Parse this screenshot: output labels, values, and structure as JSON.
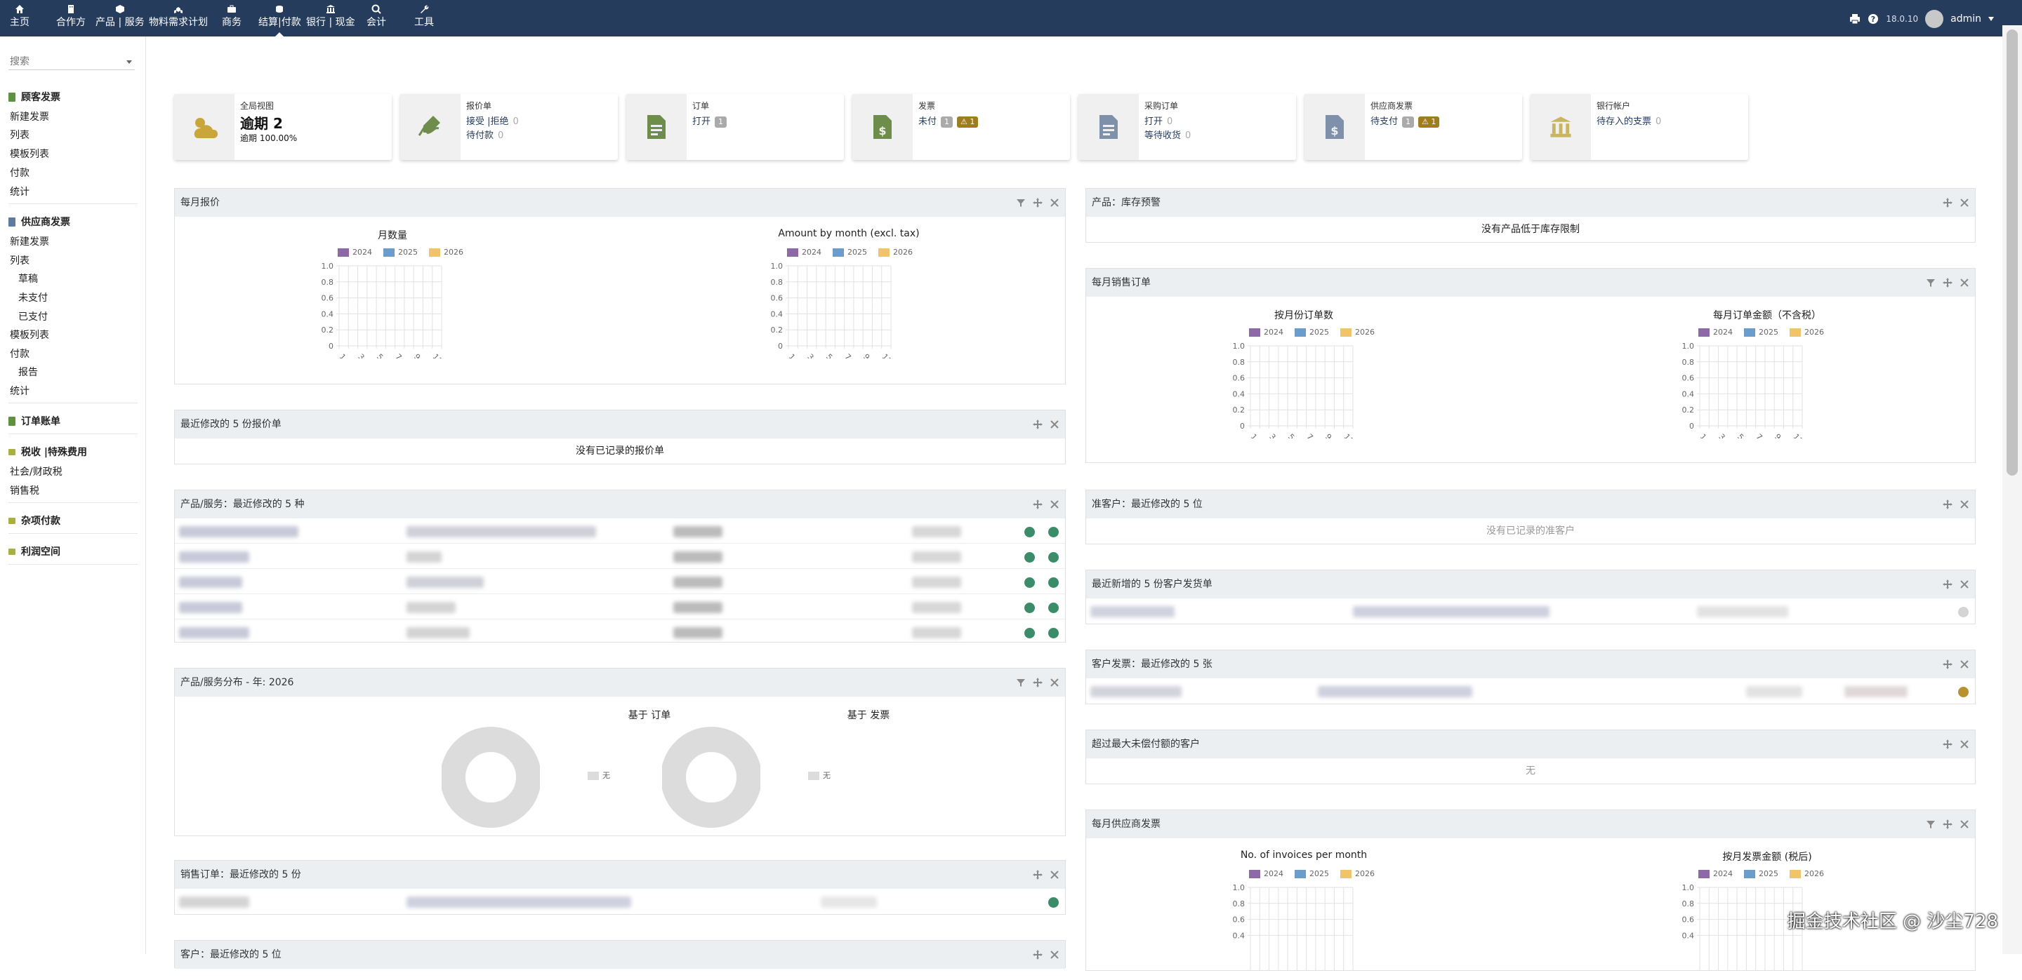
{
  "topnav": {
    "items": [
      {
        "label": "主页",
        "icon": "home-icon"
      },
      {
        "label": "合作方",
        "icon": "building-icon"
      },
      {
        "label": "产品 | 服务",
        "icon": "cube-icon"
      },
      {
        "label": "物料需求计划",
        "icon": "cubes-icon"
      },
      {
        "label": "商务",
        "icon": "briefcase-icon"
      },
      {
        "label": "结算|付款",
        "icon": "coins-icon",
        "active": true
      },
      {
        "label": "银行 | 现金",
        "icon": "bank-icon"
      },
      {
        "label": "会计",
        "icon": "search-dollar-icon"
      },
      {
        "label": "工具",
        "icon": "wrench-icon"
      }
    ],
    "version": "18.0.10",
    "user": "admin"
  },
  "sidebar": {
    "search_placeholder": "搜索",
    "customer_invoices": {
      "title": "顾客发票",
      "items": [
        "新建发票",
        "列表",
        "模板列表",
        "付款",
        "统计"
      ]
    },
    "supplier_invoices": {
      "title": "供应商发票",
      "items": [
        "新建发票",
        "列表",
        "草稿",
        "未支付",
        "已支付",
        "模板列表",
        "付款",
        "报告",
        "统计"
      ]
    },
    "orders_billing": {
      "title": "订单账单"
    },
    "taxes": {
      "title": "税收 |特殊费用",
      "items": [
        "社会/财政税",
        "销售税"
      ]
    },
    "misc_payments": {
      "title": "杂项付款"
    },
    "margins": {
      "title": "利润空间"
    }
  },
  "boxes": [
    {
      "title": "全局视图",
      "line1": "逾期 2",
      "line2": "逾期 100.00%",
      "icon": "weather-icon"
    },
    {
      "title": "报价单",
      "lines": [
        {
          "label": "接受 |拒绝",
          "count": "0"
        },
        {
          "label": "待付款",
          "count": "0"
        }
      ],
      "icon": "signature-icon"
    },
    {
      "title": "订单",
      "lines": [
        {
          "label": "打开",
          "badge": "1"
        }
      ],
      "icon": "order-doc-icon"
    },
    {
      "title": "发票",
      "lines": [
        {
          "label": "未付",
          "badge": "1",
          "warn": "1"
        }
      ],
      "icon": "invoice-dollar-icon"
    },
    {
      "title": "采购订单",
      "lines": [
        {
          "label": "打开",
          "count": "0"
        },
        {
          "label": "等待收货",
          "count": "0"
        }
      ],
      "icon": "purchase-doc-icon"
    },
    {
      "title": "供应商发票",
      "lines": [
        {
          "label": "待支付",
          "badge": "1",
          "warn": "1"
        }
      ],
      "icon": "supplier-invoice-icon"
    },
    {
      "title": "银行帐户",
      "lines": [
        {
          "label": "待存入的支票",
          "count": "0"
        }
      ],
      "icon": "bank-icon"
    }
  ],
  "panels": {
    "monthly_proposals": {
      "title": "每月报价",
      "chart1_title": "月数量",
      "chart2_title": "Amount by month (excl. tax)"
    },
    "stock_alert": {
      "title": "产品：库存预警",
      "empty": "没有产品低于库存限制"
    },
    "monthly_orders": {
      "title": "每月销售订单",
      "chart1_title": "按月份订单数",
      "chart2_title": "每月订单金额（不含税）"
    },
    "last_proposals": {
      "title": "最近修改的 5 份报价单",
      "empty": "没有已记录的报价单"
    },
    "last_products": {
      "title": "产品/服务：最近修改的 5 种"
    },
    "prospects": {
      "title": "准客户：最近修改的 5 位",
      "empty": "没有已记录的准客户"
    },
    "last_shipments": {
      "title": "最近新增的 5 份客户发货单"
    },
    "customer_invoices": {
      "title": "客户发票：最近修改的 5 张"
    },
    "over_credit": {
      "title": "超过最大未偿付额的客户",
      "empty": "无"
    },
    "product_distribution": {
      "title": "产品/服务分布 - 年: 2026",
      "donut1_title": "基于 订单",
      "donut2_title": "基于 发票",
      "legend": "无"
    },
    "monthly_supplier_invoices": {
      "title": "每月供应商发票",
      "chart1_title": "No. of invoices per month",
      "chart2_title": "按月发票金额 (税后)"
    },
    "last_orders": {
      "title": "销售订单：最近修改的 5 份"
    },
    "last_customers": {
      "title": "客户：最近修改的 5 位"
    }
  },
  "legend_years": [
    "2024",
    "2025",
    "2026"
  ],
  "colors": {
    "y2024": "#8e69a8",
    "y2025": "#6b9ccc",
    "y2026": "#f0c46a",
    "navbar": "#263c5c",
    "status_green": "#3b8c68",
    "status_gold": "#b99230",
    "status_grey": "#d4d4d4"
  },
  "chart_data": [
    {
      "type": "bar",
      "title": "月数量",
      "series": [
        {
          "name": "2024",
          "values": []
        },
        {
          "name": "2025",
          "values": []
        },
        {
          "name": "2026",
          "values": []
        }
      ],
      "x_ticks": [
        "1",
        "3",
        "5",
        "7",
        "9",
        "11"
      ],
      "y_ticks": [
        "0",
        "0.2",
        "0.4",
        "0.6",
        "0.8",
        "1.0"
      ],
      "ylim": [
        0,
        1.0
      ]
    },
    {
      "type": "bar",
      "title": "Amount by month (excl. tax)",
      "series": [
        {
          "name": "2024",
          "values": []
        },
        {
          "name": "2025",
          "values": []
        },
        {
          "name": "2026",
          "values": []
        }
      ],
      "x_ticks": [
        "1",
        "3",
        "5",
        "7",
        "9",
        "11"
      ],
      "y_ticks": [
        "0",
        "0.2",
        "0.4",
        "0.6",
        "0.8",
        "1.0"
      ],
      "ylim": [
        0,
        1.0
      ]
    },
    {
      "type": "bar",
      "title": "按月份订单数",
      "series": [
        {
          "name": "2024",
          "values": []
        },
        {
          "name": "2025",
          "values": []
        },
        {
          "name": "2026",
          "values": []
        }
      ],
      "x_ticks": [
        "1",
        "3",
        "5",
        "7",
        "9",
        "11"
      ],
      "y_ticks": [
        "0",
        "0.2",
        "0.4",
        "0.6",
        "0.8",
        "1.0"
      ],
      "ylim": [
        0,
        1.0
      ]
    },
    {
      "type": "bar",
      "title": "每月订单金额（不含税）",
      "series": [
        {
          "name": "2024",
          "values": []
        },
        {
          "name": "2025",
          "values": []
        },
        {
          "name": "2026",
          "values": []
        }
      ],
      "x_ticks": [
        "1",
        "3",
        "5",
        "7",
        "9",
        "11"
      ],
      "y_ticks": [
        "0",
        "0.2",
        "0.4",
        "0.6",
        "0.8",
        "1.0"
      ],
      "ylim": [
        0,
        1.0
      ]
    },
    {
      "type": "pie",
      "title": "基于 订单",
      "labels": [
        "无"
      ],
      "values": [
        1
      ]
    },
    {
      "type": "pie",
      "title": "基于 发票",
      "labels": [
        "无"
      ],
      "values": [
        1
      ]
    },
    {
      "type": "bar",
      "title": "No. of invoices per month",
      "series": [
        {
          "name": "2024",
          "values": []
        },
        {
          "name": "2025",
          "values": []
        },
        {
          "name": "2026",
          "values": []
        }
      ],
      "y_ticks": [
        "0.4",
        "0.6",
        "0.8",
        "1.0"
      ],
      "ylim": [
        0,
        1.0
      ]
    },
    {
      "type": "bar",
      "title": "按月发票金额 (税后)",
      "series": [
        {
          "name": "2024",
          "values": []
        },
        {
          "name": "2025",
          "values": []
        },
        {
          "name": "2026",
          "values": []
        }
      ],
      "y_ticks": [
        "0.4",
        "0.6",
        "0.8",
        "1.0"
      ],
      "ylim": [
        0,
        1.0
      ]
    }
  ],
  "watermark": "掘金技术社区 @ 沙尘728"
}
